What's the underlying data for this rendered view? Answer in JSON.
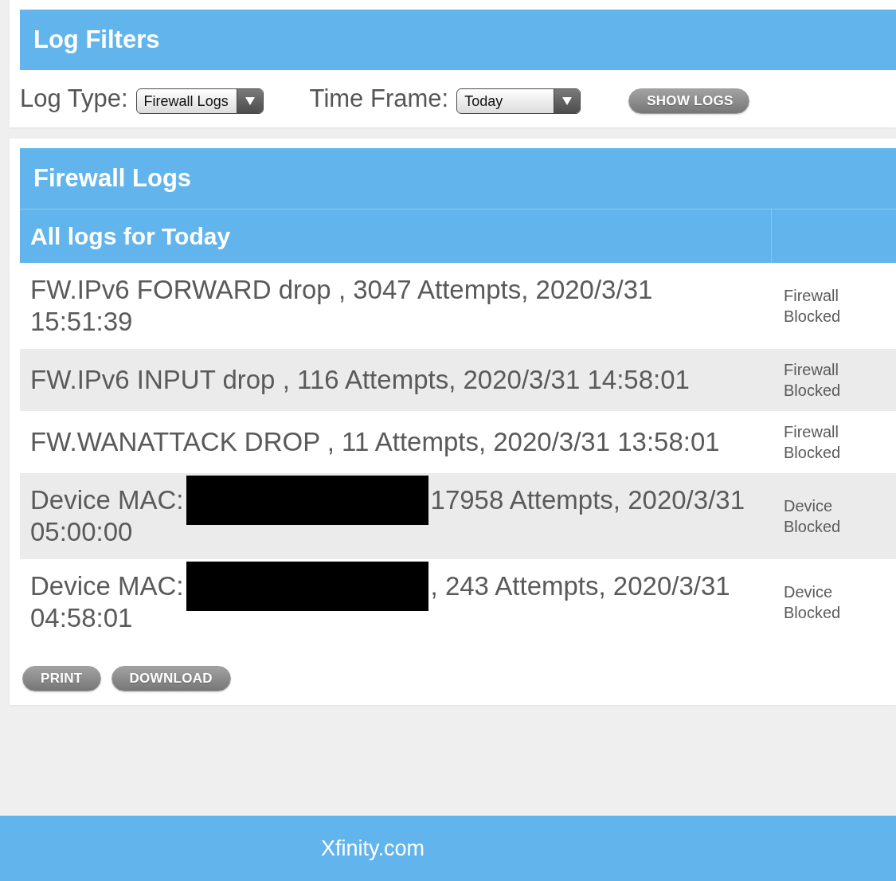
{
  "filters": {
    "title": "Log Filters",
    "log_type": {
      "label": "Log Type:",
      "value": "Firewall Logs"
    },
    "time_frame": {
      "label": "Time Frame:",
      "value": "Today"
    },
    "show_button": "SHOW LOGS"
  },
  "logs": {
    "title": "Firewall Logs",
    "subtitle": "All logs for Today",
    "rows": [
      {
        "kind": "firewall",
        "message": "FW.IPv6 FORWARD drop , 3047 Attempts, 2020/3/31 15:51:39",
        "status": "Firewall Blocked"
      },
      {
        "kind": "firewall",
        "message": "FW.IPv6 INPUT drop , 116 Attempts, 2020/3/31 14:58:01",
        "status": "Firewall Blocked"
      },
      {
        "kind": "firewall",
        "message": "FW.WANATTACK DROP , 11 Attempts, 2020/3/31 13:58:01",
        "status": "Firewall Blocked"
      },
      {
        "kind": "device",
        "label": "Device MAC:",
        "redacted": true,
        "details": "17958 Attempts, 2020/3/31",
        "time": "05:00:00",
        "status": "Device Blocked"
      },
      {
        "kind": "device",
        "label": "Device MAC:",
        "redacted": true,
        "details": ", 243 Attempts, 2020/3/31",
        "time": "04:58:01",
        "status": "Device Blocked"
      }
    ],
    "actions": [
      "PRINT",
      "DOWNLOAD"
    ]
  },
  "footer": {
    "link": "Xfinity.com"
  }
}
